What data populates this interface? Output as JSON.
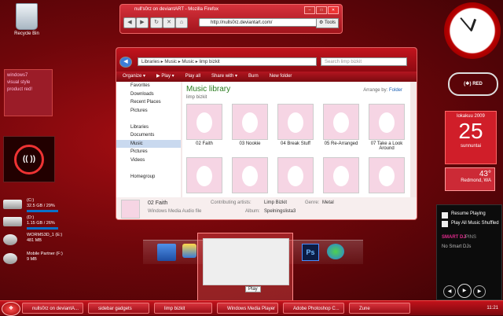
{
  "desktop": {
    "recycle_bin": "Recycle Bin",
    "note_lines": [
      "windows7",
      "visual style",
      "product red!"
    ],
    "logo_text": "(( ))",
    "drives": [
      {
        "name": "(C:)",
        "info": "32.5 GB / 29%"
      },
      {
        "name": "(D:)",
        "info": "1.15 GB / 26%"
      },
      {
        "name": "WORMS3D_1 (E:)",
        "info": "481 MB"
      },
      {
        "name": "Mobile Partner (F:)",
        "info": "9 MB"
      }
    ]
  },
  "firefox": {
    "title": "null's0rz on deviantART - Mozilla Firefox",
    "url": "http://nulls0rz.deviantart.com/",
    "tools": "Tools"
  },
  "explorer": {
    "breadcrumb": "Libraries ▸ Music ▸ Music ▸ limp bizkit",
    "search_placeholder": "Search limp bizkit",
    "menu": [
      "Organize ▾",
      "▶ Play ▾",
      "Play all",
      "Share with ▾",
      "Burn",
      "New folder"
    ],
    "sidebar": [
      "Favorites",
      "Downloads",
      "Recent Places",
      "Pictures",
      "",
      "Libraries",
      "Documents",
      "Music",
      "Pictures",
      "Videos",
      "",
      "Homegroup"
    ],
    "heading": "Music library",
    "subheading": "limp bizkit",
    "arrange_label": "Arrange by:",
    "arrange_value": "Folder",
    "tiles": [
      "02 Faith",
      "03 Nookie",
      "04 Break Stuff",
      "05 Re-Arranged",
      "07 Take a Look Around",
      "",
      "",
      "",
      "",
      ""
    ],
    "details": {
      "title": "02 Faith",
      "type": "Windows Media Audio file",
      "artists_label": "Contributing artists:",
      "artists": "Limp Bizkit",
      "album_label": "Album:",
      "album": "Spelningslista3",
      "genre_label": "Genre:",
      "genre": "Metal"
    }
  },
  "widgets": {
    "win_button": "RED",
    "calendar_month": "lokakuu 2009",
    "calendar_day": "25",
    "calendar_weekday": "sunnuntai",
    "weather_temp": "43°",
    "weather_city": "Redmond, WA",
    "zune_items": [
      "Resume Playing",
      "Play All Music Shuffled"
    ],
    "zune_smart": "SMART DJ",
    "zune_pins": "PINS",
    "zune_empty": "No Smart DJs",
    "zune_time": "11:21"
  },
  "dock": {
    "tooltip": "Play"
  },
  "taskbar": {
    "start": "❖",
    "items": [
      "nulls0rz on deviantA...",
      "sidebar gadgets",
      "limp bizkit",
      "Windows Media Player",
      "Adobe Photoshop C...",
      "Zune"
    ],
    "clock": "11:21"
  }
}
